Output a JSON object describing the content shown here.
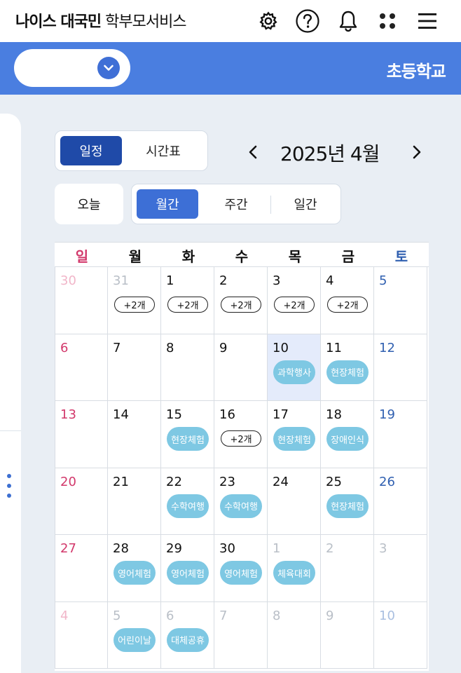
{
  "header": {
    "brand_bold": "나이스 대국민",
    "brand_rest": "학부모서비스",
    "icons": [
      "gear-icon",
      "help-icon",
      "bell-icon",
      "apps-icon",
      "menu-icon"
    ]
  },
  "school_bar": {
    "select_value": "",
    "school_name": "초등학교"
  },
  "view_toggle": {
    "schedule": "일정",
    "timetable": "시간표"
  },
  "month_nav": {
    "title": "2025년 4월",
    "prev": "‹",
    "next": "›"
  },
  "period": {
    "today": "오늘",
    "monthly": "월간",
    "weekly": "주간",
    "daily": "일간"
  },
  "calendar": {
    "weekdays": [
      "일",
      "월",
      "화",
      "수",
      "목",
      "금",
      "토"
    ],
    "weeks": [
      [
        {
          "day": "30",
          "tone": "pink"
        },
        {
          "day": "31",
          "tone": "gray",
          "more": "+2개"
        },
        {
          "day": "1",
          "more": "+2개"
        },
        {
          "day": "2",
          "more": "+2개"
        },
        {
          "day": "3",
          "more": "+2개"
        },
        {
          "day": "4",
          "more": "+2개"
        },
        {
          "day": "5",
          "tone": "blue"
        }
      ],
      [
        {
          "day": "6",
          "tone": "red"
        },
        {
          "day": "7"
        },
        {
          "day": "8"
        },
        {
          "day": "9"
        },
        {
          "day": "10",
          "highlight": true,
          "event": "과학행사"
        },
        {
          "day": "11",
          "event": "현장체험"
        },
        {
          "day": "12",
          "tone": "blue"
        }
      ],
      [
        {
          "day": "13",
          "tone": "red"
        },
        {
          "day": "14"
        },
        {
          "day": "15",
          "event": "현장체험"
        },
        {
          "day": "16",
          "more": "+2개"
        },
        {
          "day": "17",
          "event": "현장체험"
        },
        {
          "day": "18",
          "event": "장애인식"
        },
        {
          "day": "19",
          "tone": "blue"
        }
      ],
      [
        {
          "day": "20",
          "tone": "red"
        },
        {
          "day": "21"
        },
        {
          "day": "22",
          "event": "수학여행"
        },
        {
          "day": "23",
          "event": "수학여행"
        },
        {
          "day": "24"
        },
        {
          "day": "25",
          "event": "현장체험"
        },
        {
          "day": "26",
          "tone": "blue"
        }
      ],
      [
        {
          "day": "27",
          "tone": "red"
        },
        {
          "day": "28",
          "event": "영어체험"
        },
        {
          "day": "29",
          "event": "영어체험"
        },
        {
          "day": "30",
          "event": "영어체험"
        },
        {
          "day": "1",
          "tone": "gray",
          "event": "체육대회"
        },
        {
          "day": "2",
          "tone": "gray"
        },
        {
          "day": "3",
          "tone": "gray"
        }
      ],
      [
        {
          "day": "4",
          "tone": "pink"
        },
        {
          "day": "5",
          "tone": "gray",
          "event": "어린이날"
        },
        {
          "day": "6",
          "tone": "gray",
          "event": "대체공휴"
        },
        {
          "day": "7",
          "tone": "gray"
        },
        {
          "day": "8",
          "tone": "gray"
        },
        {
          "day": "9",
          "tone": "gray"
        },
        {
          "day": "10",
          "tone": "lblue"
        }
      ]
    ]
  },
  "colors": {
    "brand_blue": "#4a7ee0",
    "active_dark": "#1f4aa8",
    "event_bg": "#7ec8e3",
    "sunday": "#d2386b",
    "saturday": "#2f5fb0"
  }
}
